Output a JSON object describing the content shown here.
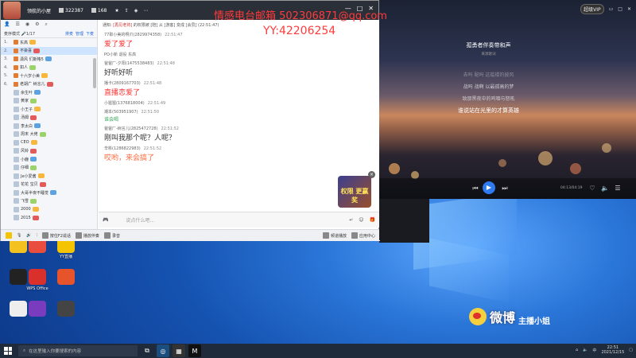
{
  "desktop": {
    "icons": [
      {
        "label": "",
        "color": "#f3c220"
      },
      {
        "label": "",
        "color": "#e84d3d"
      },
      {
        "label": "YY直播",
        "color": "#f5c400"
      },
      {
        "label": "",
        "color": "#222"
      },
      {
        "label": "WPS Office",
        "color": "#d9302b"
      },
      {
        "label": "",
        "color": "#e7532a"
      },
      {
        "label": "",
        "color": "#eeeeee"
      },
      {
        "label": "",
        "color": "#7a3cbf"
      },
      {
        "label": "",
        "color": "#444"
      }
    ]
  },
  "watermark": {
    "text": "微博",
    "sub": "主播小姐"
  },
  "music": {
    "vip_label": "超级VIP",
    "song": "孤勇者伴奏带和声",
    "artist": "来源歌词",
    "lines": [
      "去吗 配吗 这褴褛的披风",
      "战吗 战啊 以最孤高的梦",
      "致那黑夜中的呜咽与怒吼",
      "谁说站在光里的才算英雄"
    ],
    "time": "04:13/04:19"
  },
  "chat": {
    "room_name": "领航的小屋",
    "viewer_count": "322387",
    "fans_count": "168",
    "overlay_title": "情感电台邮箱 502306871@qq.com",
    "overlay_yy": "YY:42206254",
    "mode_label": "麦序模式",
    "mode_count": "1/17",
    "mode_links": [
      "排麦",
      "管理",
      "下麦"
    ],
    "users": [
      {
        "num": "1.",
        "name": "东高",
        "sel": false
      },
      {
        "num": "2.",
        "name": "不染喜",
        "sel": true
      },
      {
        "num": "3.",
        "name": "潇风 们斯格5",
        "sel": false
      },
      {
        "num": "4.",
        "name": "如人",
        "sel": false
      },
      {
        "num": "5.",
        "name": "十六岁小美",
        "sel": false
      },
      {
        "num": "6.",
        "name": "老胡广 树言儿",
        "sel": false
      },
      {
        "num": "",
        "name": "余生叶",
        "sel": false
      },
      {
        "num": "",
        "name": "黄家",
        "sel": false
      },
      {
        "num": "",
        "name": "小王子",
        "sel": false
      },
      {
        "num": "",
        "name": "汤姆",
        "sel": false
      },
      {
        "num": "",
        "name": "李太白",
        "sel": false
      },
      {
        "num": "",
        "name": "周末 大佬",
        "sel": false
      },
      {
        "num": "",
        "name": "CEO",
        "sel": false
      },
      {
        "num": "",
        "name": "风铃",
        "sel": false
      },
      {
        "num": "",
        "name": "小鹿",
        "sel": false
      },
      {
        "num": "",
        "name": "仔细",
        "sel": false
      },
      {
        "num": "",
        "name": "Je小爱酱",
        "sel": false
      },
      {
        "num": "",
        "name": "花花 宝贝",
        "sel": false
      },
      {
        "num": "",
        "name": "大哥半夜不睡觉",
        "sel": false
      },
      {
        "num": "",
        "name": "飞雪",
        "sel": false
      },
      {
        "num": "",
        "name": "2000",
        "sel": false
      },
      {
        "num": "",
        "name": "2015",
        "sel": false
      }
    ],
    "notice": {
      "prefix": "通知:",
      "room": "[再见老将]",
      "text": "的权限被 [陪] 从 [游客] 变成 [会员]",
      "time": "(22:51:47)"
    },
    "messages": [
      {
        "user": "77职小美的啊爪(2829974358)",
        "time": "22:51:47",
        "text": "爱了爱了",
        "color": "red"
      },
      {
        "user": "PO小新 退役 东高",
        "time": "",
        "text": "",
        "color": ""
      },
      {
        "user": "爸爸厂-夕阳(1475538483)",
        "time": "22:51:48",
        "text": "好听好听",
        "color": ""
      },
      {
        "user": "播卡(2809167703)",
        "time": "22:51:48",
        "text": "直播恋爱了",
        "color": "red"
      },
      {
        "user": "小猩猩(1376818004)",
        "time": "22:51:49",
        "text": "",
        "color": ""
      },
      {
        "user": "潮本(503951907)",
        "time": "22:51:50",
        "text": "谁会喝",
        "color": "green"
      },
      {
        "user": "爸爸厂-树言儿(2825472728)",
        "time": "22:51:52",
        "text": "刚叫我那个呢？人呢？",
        "color": ""
      },
      {
        "user": "辛彬(1286822983)",
        "time": "22:51:52",
        "text": "哎哟，来会搞了",
        "color": "orange"
      }
    ],
    "promo_text": "权限 更赢奖",
    "input_placeholder": "说点什么吧...",
    "bottom_bar": {
      "ptt": "按住F2说话",
      "music": "播放伴奏",
      "record": "录音",
      "chat": "频道播放",
      "app": "应用中心"
    }
  },
  "taskbar": {
    "search_placeholder": "在这里输入你要搜索的内容",
    "time": "22:51",
    "date": "2021/12/15"
  }
}
